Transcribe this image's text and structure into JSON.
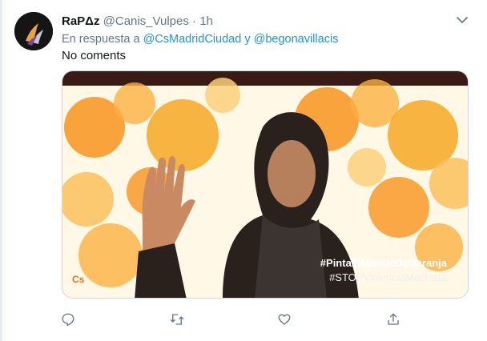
{
  "tweet": {
    "display_name": "RaPΔz",
    "handle": "@Canis_Vulpes",
    "separator": "·",
    "time": "1h",
    "reply_prefix": "En respuesta a",
    "reply_mention_1": "@CsMadridCiudad",
    "reply_conjunction": "y",
    "reply_mention_2": "@begonavillacis",
    "text": "No coments"
  },
  "media": {
    "hashtag_primary": "#PintaElMundoDeNaranja",
    "hashtag_secondary": "#STOPViolenciaMachista",
    "logo_text": "Cs"
  },
  "icons": {
    "menu": "chevron-down-icon",
    "reply": "reply-icon",
    "retweet": "retweet-icon",
    "like": "heart-icon",
    "share": "share-icon"
  },
  "colors": {
    "link": "#1b95e0",
    "muted": "#657786",
    "text": "#14171a",
    "accent_orange": "#f7941d"
  }
}
